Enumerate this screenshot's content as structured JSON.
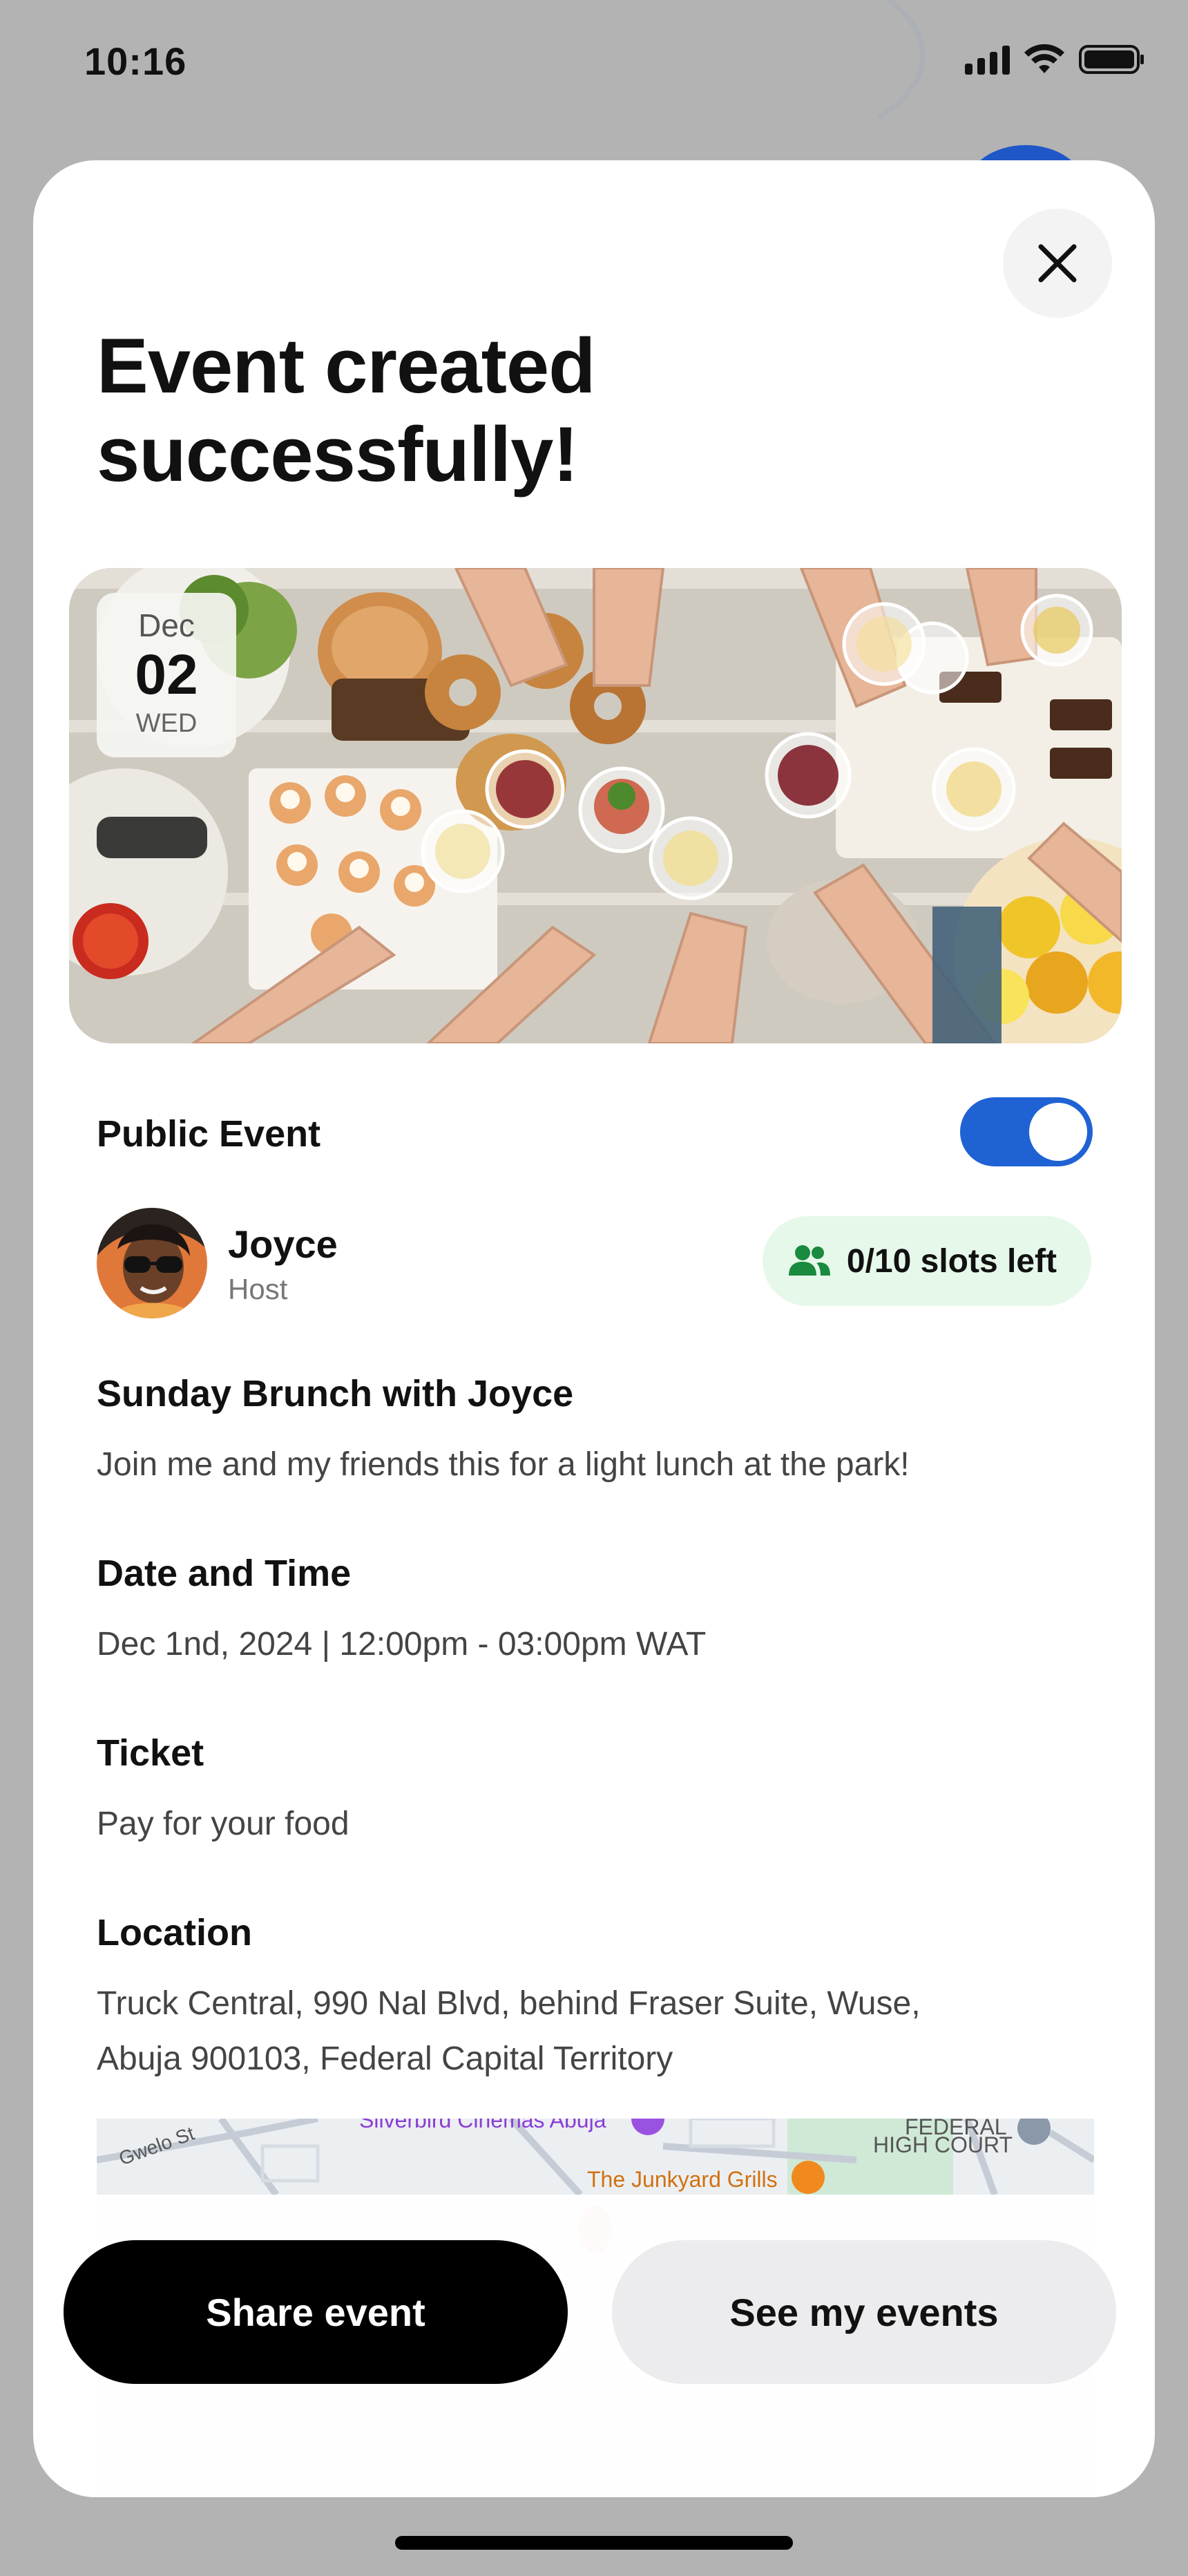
{
  "status_bar": {
    "time": "10:16"
  },
  "modal": {
    "title_line1": "Event created",
    "title_line2": "successfully!",
    "date_badge": {
      "month": "Dec",
      "day": "02",
      "weekday": "WED"
    },
    "public_event_label": "Public Event",
    "public_event_enabled": true,
    "host": {
      "name": "Joyce",
      "role": "Host"
    },
    "slots_label": "0/10 slots left",
    "event_title": "Sunday Brunch with Joyce",
    "event_description": "Join me and my friends this for a light lunch at the park!",
    "date_time": {
      "heading": "Date and Time",
      "value": "Dec 1nd, 2024 | 12:00pm - 03:00pm WAT"
    },
    "ticket": {
      "heading": "Ticket",
      "value": "Pay for your food"
    },
    "location": {
      "heading": "Location",
      "line1": "Truck Central, 990 Nal Blvd, behind Fraser Suite, Wuse,",
      "line2": "Abuja 900103, Federal Capital Territory"
    },
    "map": {
      "labels": [
        "Gwelo St",
        "Silverbird Cinemas Abuja",
        "FEDERAL",
        "HIGH COURT",
        "The Junkyard Grills"
      ]
    },
    "actions": {
      "share_label": "Share event",
      "events_label": "See my events"
    }
  },
  "colors": {
    "accent_blue": "#1f62d4",
    "slots_bg": "#e6f8ea",
    "slots_icon": "#1a8a3e",
    "primary_button": "#000000",
    "secondary_button": "#ececee"
  }
}
